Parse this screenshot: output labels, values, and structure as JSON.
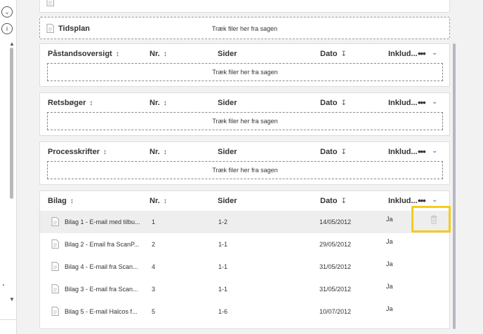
{
  "top_partial": {},
  "tidsplan": {
    "title": "Tidsplan",
    "drop_text": "Træk filer her fra sagen"
  },
  "columns": {
    "nr": "Nr.",
    "sider": "Sider",
    "dato": "Dato",
    "inkluder": "Inklud..."
  },
  "icons": {
    "sort": "sort-icon",
    "sort_desc": "sort-desc-icon",
    "more": "more-icon",
    "chevron": "chevron-down-icon",
    "doc": "document-icon",
    "trash": "trash-icon"
  },
  "sections": {
    "paastand": {
      "title": "Påstandsoversigt",
      "drop_text": "Træk filer her fra sagen"
    },
    "retsbog": {
      "title": "Retsbøger",
      "drop_text": "Træk filer her fra sagen"
    },
    "process": {
      "title": "Processkrifter",
      "drop_text": "Træk filer her fra sagen"
    },
    "bilag": {
      "title": "Bilag",
      "rows": [
        {
          "name": "Bilag 1 - E-mail med tilbu...",
          "nr": "1",
          "sider": "1-2",
          "dato": "14/05/2012",
          "inkluder": "Ja"
        },
        {
          "name": "Bilag 2 - Email fra ScanP...",
          "nr": "2",
          "sider": "1-1",
          "dato": "29/05/2012",
          "inkluder": "Ja"
        },
        {
          "name": "Bilag 4 - E-mail fra Scan...",
          "nr": "4",
          "sider": "1-1",
          "dato": "31/05/2012",
          "inkluder": "Ja"
        },
        {
          "name": "Bilag 3 - E-mail fra Scan...",
          "nr": "3",
          "sider": "1-1",
          "dato": "31/05/2012",
          "inkluder": "Ja"
        },
        {
          "name": "Bilag 5 - E-mail Halcos f...",
          "nr": "5",
          "sider": "1-6",
          "dato": "10/07/2012",
          "inkluder": "Ja"
        }
      ]
    }
  },
  "colors": {
    "accent": "#1f6fc2",
    "highlight": "#f5cc1b",
    "scrollbar": "#b5b7c4"
  }
}
